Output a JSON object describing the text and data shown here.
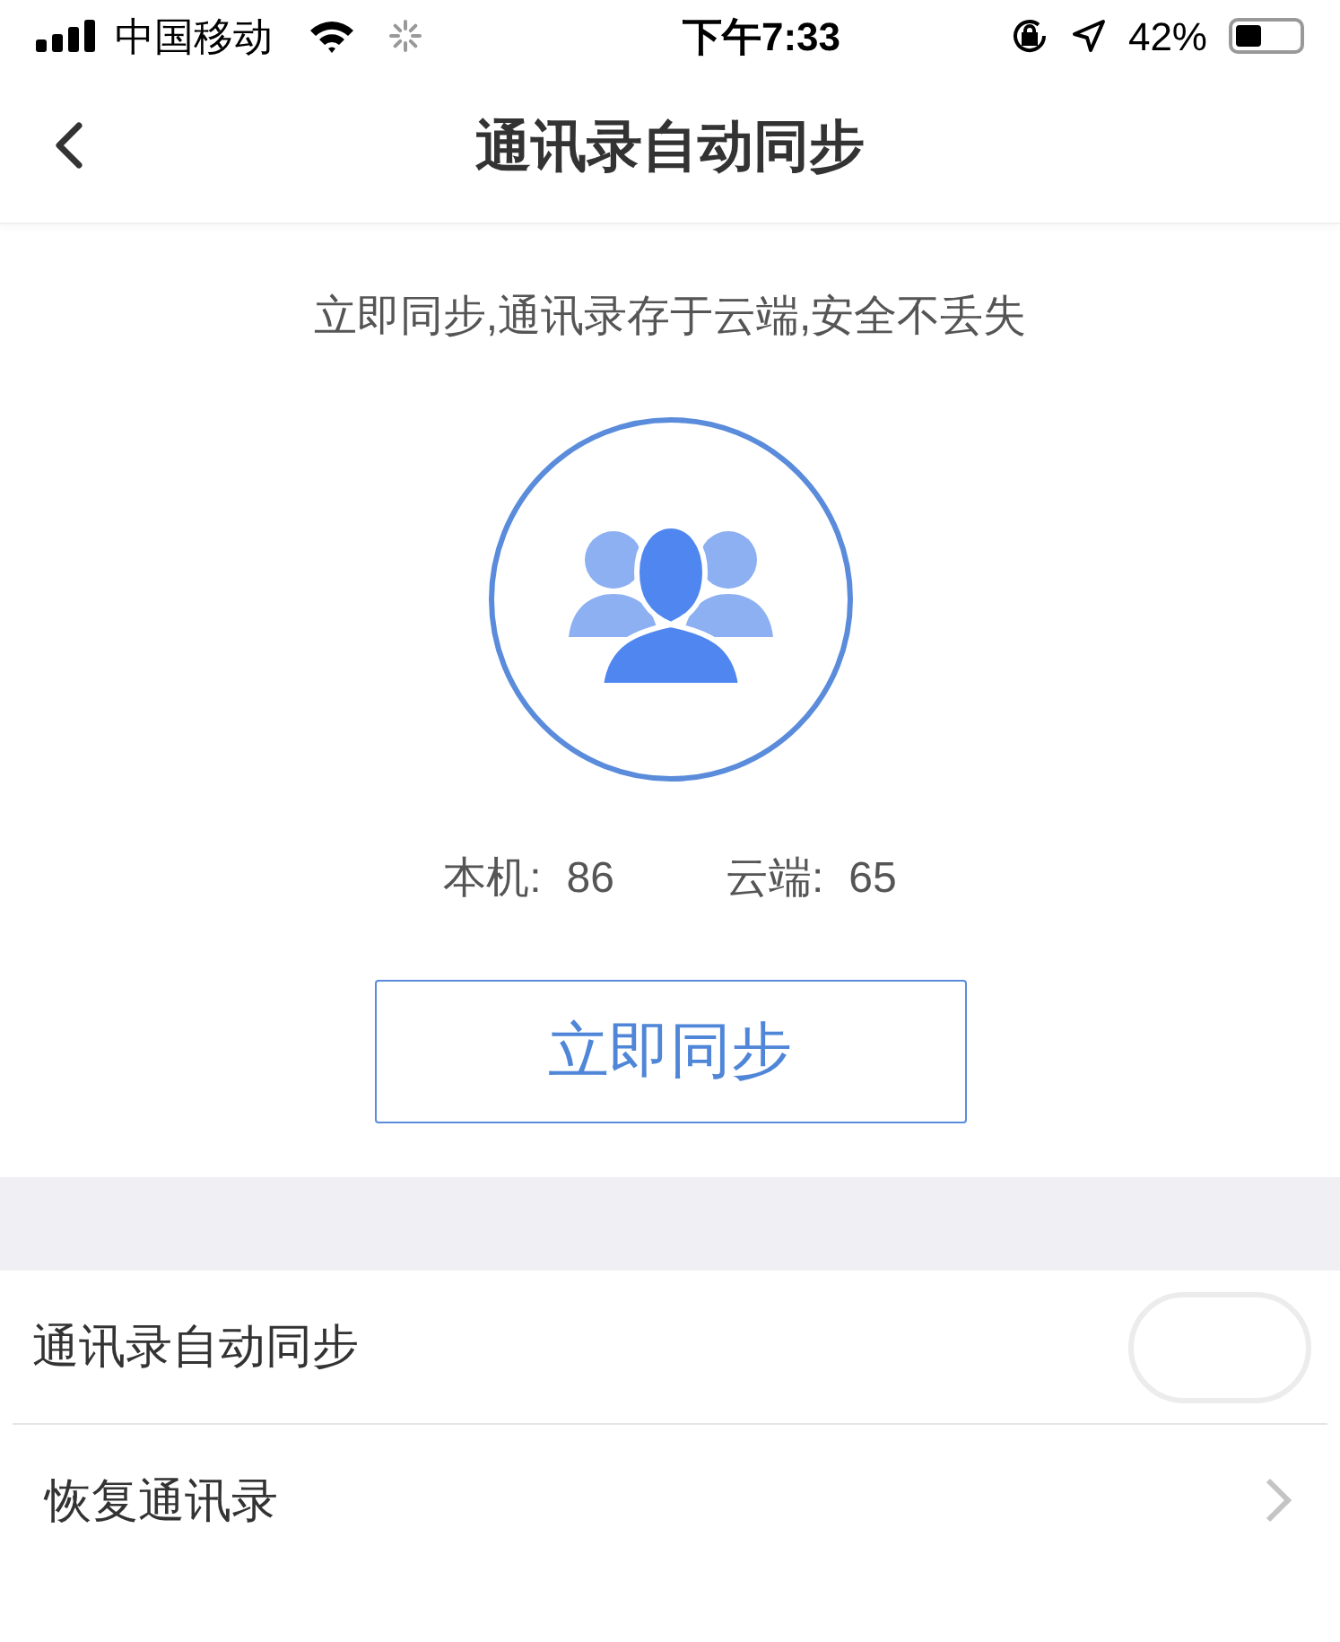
{
  "status_bar": {
    "carrier": "中国移动",
    "time": "下午7:33",
    "battery": "42%"
  },
  "nav": {
    "title": "通讯录自动同步"
  },
  "subtitle": "立即同步,通讯录存于云端,安全不丢失",
  "counts": [
    {
      "label": "本机:",
      "value": "86"
    },
    {
      "label": "云端:",
      "value": "65"
    }
  ],
  "sync_button": "立即同步",
  "settings": [
    {
      "kind": "toggle",
      "label": "通讯录自动同步",
      "on": false
    },
    {
      "kind": "link",
      "label": "恢复通讯录"
    }
  ]
}
